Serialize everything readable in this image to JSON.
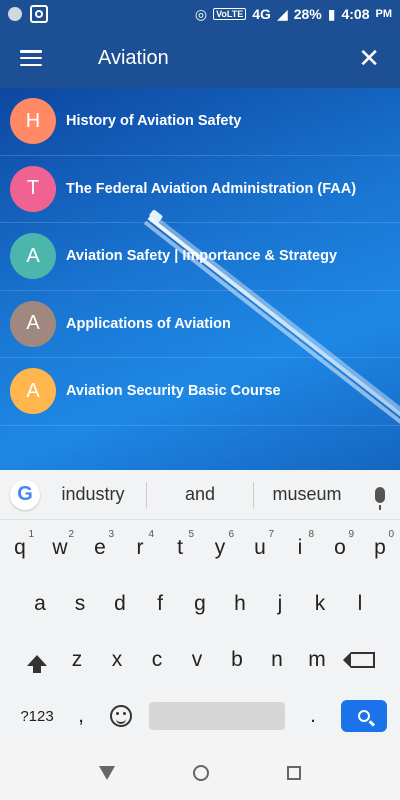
{
  "status_bar": {
    "battery": "28%",
    "time": "4:08",
    "ampm": "PM",
    "network": "4G",
    "volte": "VoLTE"
  },
  "app_bar": {
    "title": "Aviation"
  },
  "list": [
    {
      "letter": "H",
      "label": "History of Aviation Safety",
      "color": "#ff8a65"
    },
    {
      "letter": "T",
      "label": "The Federal Aviation Administration (FAA)",
      "color": "#f06292"
    },
    {
      "letter": "A",
      "label": "Aviation Safety | Importance & Strategy",
      "color": "#4db6ac"
    },
    {
      "letter": "A",
      "label": "Applications of Aviation",
      "color": "#a1887f"
    },
    {
      "letter": "A",
      "label": "Aviation Security Basic Course",
      "color": "#ffb74d"
    }
  ],
  "keyboard": {
    "suggestions": [
      "industry",
      "and",
      "museum"
    ],
    "row1": [
      {
        "k": "q",
        "n": "1"
      },
      {
        "k": "w",
        "n": "2"
      },
      {
        "k": "e",
        "n": "3"
      },
      {
        "k": "r",
        "n": "4"
      },
      {
        "k": "t",
        "n": "5"
      },
      {
        "k": "y",
        "n": "6"
      },
      {
        "k": "u",
        "n": "7"
      },
      {
        "k": "i",
        "n": "8"
      },
      {
        "k": "o",
        "n": "9"
      },
      {
        "k": "p",
        "n": "0"
      }
    ],
    "row2": [
      "a",
      "s",
      "d",
      "f",
      "g",
      "h",
      "j",
      "k",
      "l"
    ],
    "row3": [
      "z",
      "x",
      "c",
      "v",
      "b",
      "n",
      "m"
    ],
    "symbols_label": "?123",
    "comma": ",",
    "period": "."
  }
}
